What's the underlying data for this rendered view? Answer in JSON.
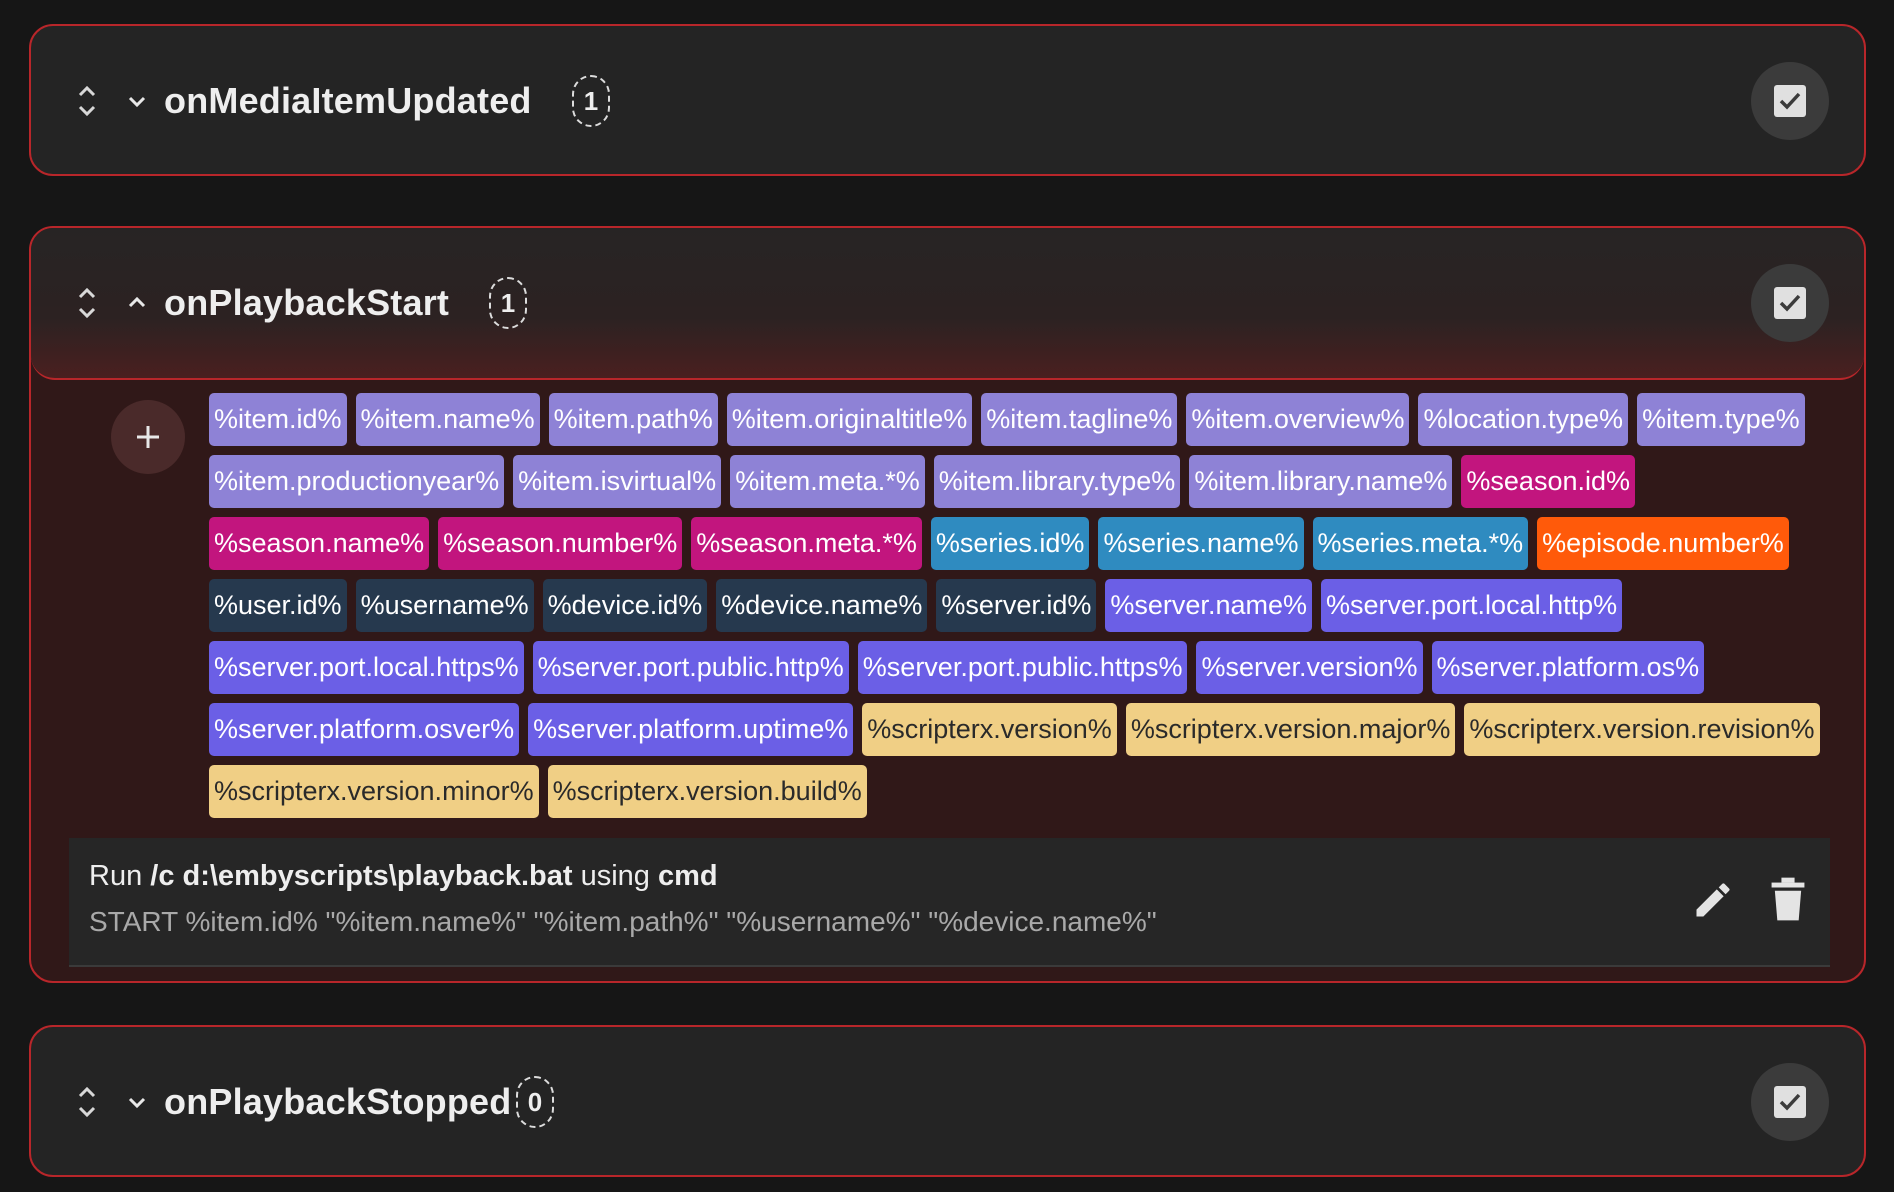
{
  "panels": [
    {
      "title": "onMediaItemUpdated",
      "count": "1",
      "expanded": false
    },
    {
      "title": "onPlaybackStart",
      "count": "1",
      "expanded": true
    },
    {
      "title": "onPlaybackStopped",
      "count": "0",
      "expanded": false
    }
  ],
  "colors": {
    "item": "#8e82d6",
    "season": "#c2157e",
    "series": "#2f8bc0",
    "episode": "#ff5a0a",
    "user": "#26394e",
    "server": "#6b5fe6",
    "scripterx": "#f0cf85",
    "border": "#b8262a"
  },
  "tags": [
    {
      "label": "%item.id%",
      "group": "item"
    },
    {
      "label": "%item.name%",
      "group": "item"
    },
    {
      "label": "%item.path%",
      "group": "item"
    },
    {
      "label": "%item.originaltitle%",
      "group": "item"
    },
    {
      "label": "%item.tagline%",
      "group": "item"
    },
    {
      "label": "%item.overview%",
      "group": "item"
    },
    {
      "label": "%location.type%",
      "group": "item"
    },
    {
      "label": "%item.type%",
      "group": "item"
    },
    {
      "label": "%item.productionyear%",
      "group": "item"
    },
    {
      "label": "%item.isvirtual%",
      "group": "item"
    },
    {
      "label": "%item.meta.*%",
      "group": "item"
    },
    {
      "label": "%item.library.type%",
      "group": "item"
    },
    {
      "label": "%item.library.name%",
      "group": "item"
    },
    {
      "label": "%season.id%",
      "group": "season"
    },
    {
      "label": "%season.name%",
      "group": "season"
    },
    {
      "label": "%season.number%",
      "group": "season"
    },
    {
      "label": "%season.meta.*%",
      "group": "season"
    },
    {
      "label": "%series.id%",
      "group": "series"
    },
    {
      "label": "%series.name%",
      "group": "series"
    },
    {
      "label": "%series.meta.*%",
      "group": "series"
    },
    {
      "label": "%episode.number%",
      "group": "episode"
    },
    {
      "label": "%user.id%",
      "group": "user"
    },
    {
      "label": "%username%",
      "group": "user"
    },
    {
      "label": "%device.id%",
      "group": "user"
    },
    {
      "label": "%device.name%",
      "group": "user"
    },
    {
      "label": "%server.id%",
      "group": "user"
    },
    {
      "label": "%server.name%",
      "group": "server"
    },
    {
      "label": "%server.port.local.http%",
      "group": "server"
    },
    {
      "label": "%server.port.local.https%",
      "group": "server"
    },
    {
      "label": "%server.port.public.http%",
      "group": "server"
    },
    {
      "label": "%server.port.public.https%",
      "group": "server"
    },
    {
      "label": "%server.version%",
      "group": "server"
    },
    {
      "label": "%server.platform.os%",
      "group": "server"
    },
    {
      "label": "%server.platform.osver%",
      "group": "server"
    },
    {
      "label": "%server.platform.uptime%",
      "group": "server"
    },
    {
      "label": "%scripterx.version%",
      "group": "scripterx"
    },
    {
      "label": "%scripterx.version.major%",
      "group": "scripterx"
    },
    {
      "label": "%scripterx.version.revision%",
      "group": "scripterx"
    },
    {
      "label": "%scripterx.version.minor%",
      "group": "scripterx"
    },
    {
      "label": "%scripterx.version.build%",
      "group": "scripterx"
    }
  ],
  "command": {
    "run_prefix": "Run",
    "script": "/c d:\\embyscripts\\playback.bat",
    "using_word": "using",
    "interpreter": "cmd",
    "args": "START %item.id% \"%item.name%\" \"%item.path%\" \"%username%\" \"%device.name%\""
  },
  "icons": {
    "drag": "unfold-icon",
    "expand": "chevron-down-icon",
    "collapse": "chevron-up-icon",
    "checkbox": "checkbox-checked-icon",
    "add": "plus-icon",
    "edit": "pencil-icon",
    "delete": "trash-icon"
  }
}
